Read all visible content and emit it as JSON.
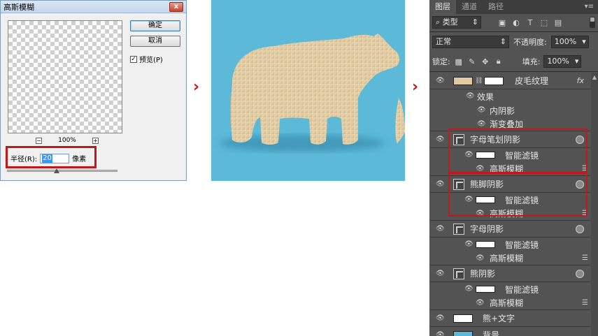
{
  "dialog": {
    "title": "高斯模糊",
    "close_label": "x",
    "ok_label": "确定",
    "cancel_label": "取消",
    "preview_check_mark": "✓",
    "preview_label": "预览(P)",
    "zoom_minus": "−",
    "zoom_value": "100%",
    "zoom_plus": "+",
    "radius_label": "半径(R):",
    "radius_value": "20",
    "radius_unit": "像素",
    "radius_slider_level": 0.45
  },
  "arrows": {
    "symbol": "›"
  },
  "layers_panel": {
    "tabs": [
      "图层",
      "通道",
      "路径"
    ],
    "menu_icon": "▾≡",
    "filter_kind": "类型",
    "blend_mode": "正常",
    "opacity_label": "不透明度:",
    "opacity_value": "100%",
    "lock_label": "锁定:",
    "fill_label": "填充:",
    "fill_value": "100%",
    "layers": [
      {
        "name": "皮毛纹理",
        "fx": "fx",
        "effects_label": "效果",
        "effects": [
          "内阴影",
          "渐变叠加"
        ]
      },
      {
        "name": "字母笔划阴影",
        "filter_group": "智能滤镜",
        "filter": "高斯模糊"
      },
      {
        "name": "熊脚阴影",
        "filter_group": "智能滤镜",
        "filter": "高斯模糊"
      },
      {
        "name": "字母阴影",
        "filter_group": "智能滤镜",
        "filter": "高斯模糊"
      },
      {
        "name": "熊阴影",
        "filter_group": "智能滤镜",
        "filter": "高斯模糊"
      },
      {
        "name": "熊+文字"
      },
      {
        "name": "背景"
      }
    ]
  },
  "colors": {
    "highlight": "#c0181b",
    "panel_bg": "#535353",
    "canvas_bg": "#5cb9d8",
    "fur": "#e6d3ae",
    "background_thumb": "#5cb9d8"
  }
}
